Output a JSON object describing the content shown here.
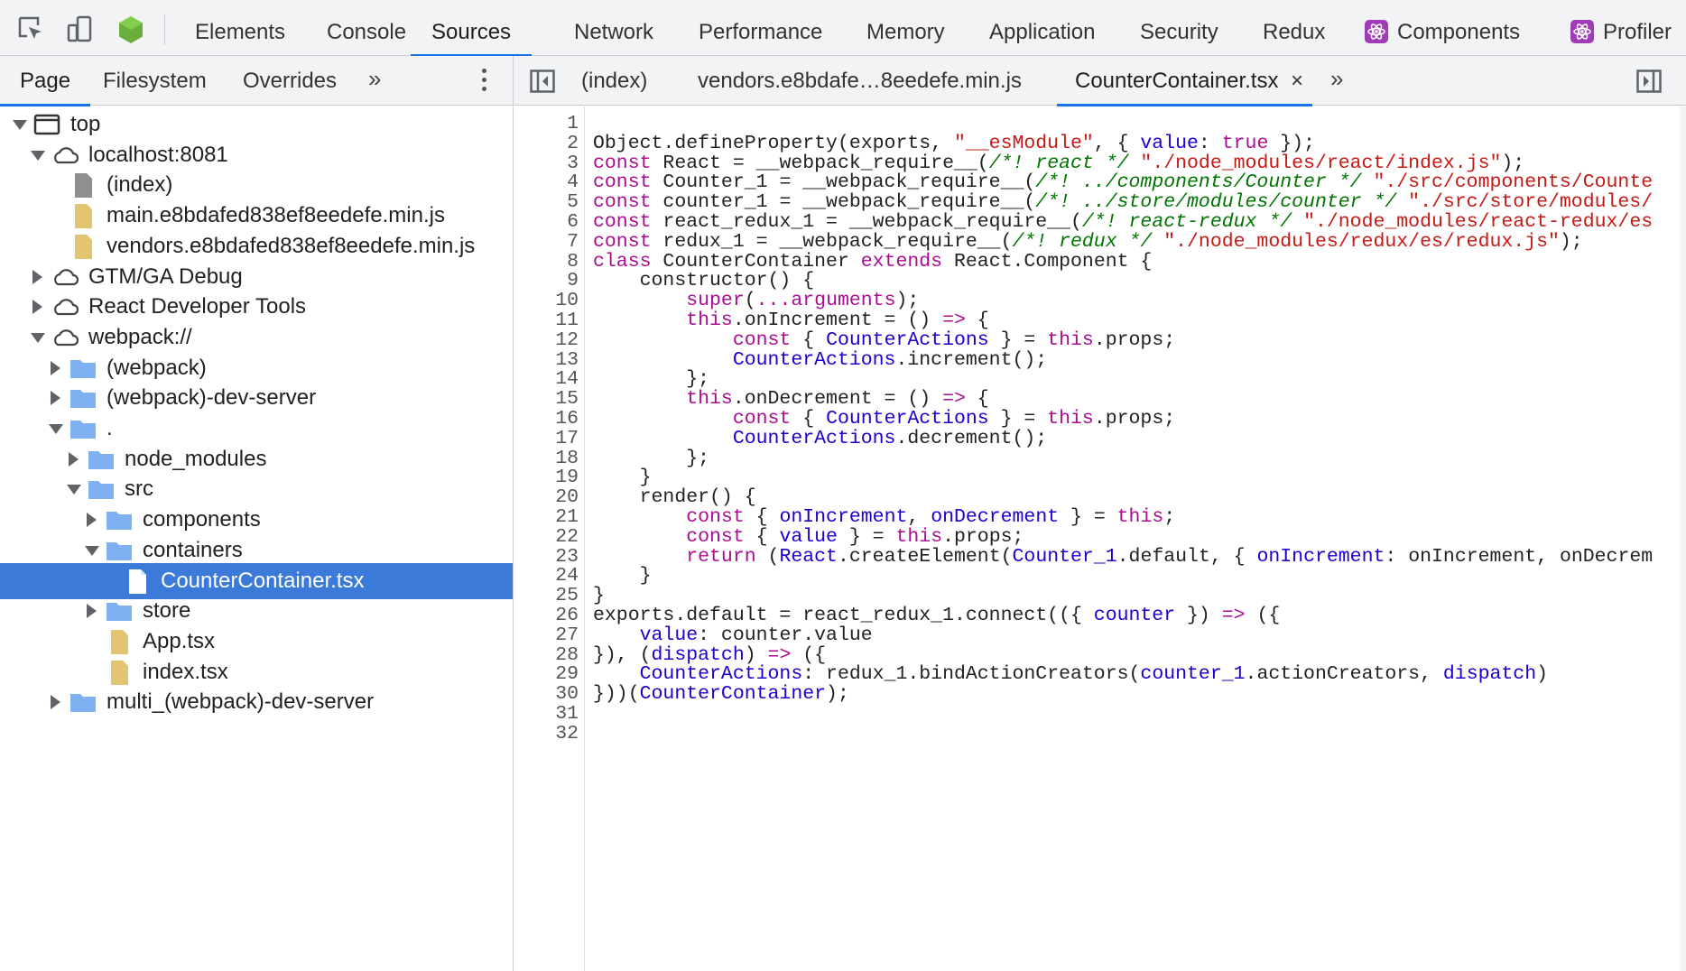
{
  "toolbar": {
    "tabs": [
      "Elements",
      "Console",
      "Sources",
      "Network",
      "Performance",
      "Memory",
      "Application",
      "Security",
      "Redux",
      "Components",
      "Profiler"
    ],
    "active_tab": "Sources",
    "accent_color": "#1a73e8"
  },
  "navigator": {
    "tabs": [
      "Page",
      "Filesystem",
      "Overrides"
    ],
    "more": "»",
    "tree": [
      {
        "label": "top",
        "icon": "frame-icon",
        "state": "open"
      },
      {
        "label": "localhost:8081",
        "icon": "cloud-icon",
        "state": "open"
      },
      {
        "label": "(index)",
        "icon": "file-gray-icon",
        "state": "leaf"
      },
      {
        "label": "main.e8bdafed838ef8eedefe.min.js",
        "icon": "file-js-icon",
        "state": "leaf"
      },
      {
        "label": "vendors.e8bdafed838ef8eedefe.min.js",
        "icon": "file-js-icon",
        "state": "leaf"
      },
      {
        "label": "GTM/GA Debug",
        "icon": "cloud-icon",
        "state": "closed"
      },
      {
        "label": "React Developer Tools",
        "icon": "cloud-icon",
        "state": "closed"
      },
      {
        "label": "webpack://",
        "icon": "cloud-icon",
        "state": "open"
      },
      {
        "label": "(webpack)",
        "icon": "folder-icon",
        "state": "closed"
      },
      {
        "label": "(webpack)-dev-server",
        "icon": "folder-icon",
        "state": "closed"
      },
      {
        "label": ".",
        "icon": "folder-icon",
        "state": "open"
      },
      {
        "label": "node_modules",
        "icon": "folder-icon",
        "state": "closed"
      },
      {
        "label": "src",
        "icon": "folder-icon",
        "state": "open"
      },
      {
        "label": "components",
        "icon": "folder-icon",
        "state": "closed"
      },
      {
        "label": "containers",
        "icon": "folder-icon",
        "state": "open"
      },
      {
        "label": "CounterContainer.tsx",
        "icon": "file-white-icon",
        "state": "leaf",
        "selected": true
      },
      {
        "label": "store",
        "icon": "folder-icon",
        "state": "closed"
      },
      {
        "label": "App.tsx",
        "icon": "file-js-icon",
        "state": "leaf"
      },
      {
        "label": "index.tsx",
        "icon": "file-js-icon",
        "state": "leaf"
      },
      {
        "label": "multi_(webpack)-dev-server",
        "icon": "folder-icon",
        "state": "closed"
      }
    ]
  },
  "editor": {
    "tabs": [
      "(index)",
      "vendors.e8bdafe…8eedefe.min.js",
      "CounterContainer.tsx"
    ],
    "active_tab": "CounterContainer.tsx",
    "close_glyph": "×",
    "more": "»",
    "lines": [
      "",
      "Object.defineProperty(exports, \"__esModule\", { value: true });",
      "const React = __webpack_require__(/*! react */ \"./node_modules/react/index.js\");",
      "const Counter_1 = __webpack_require__(/*! ../components/Counter */ \"./src/components/Counte",
      "const counter_1 = __webpack_require__(/*! ../store/modules/counter */ \"./src/store/modules/",
      "const react_redux_1 = __webpack_require__(/*! react-redux */ \"./node_modules/react-redux/es",
      "const redux_1 = __webpack_require__(/*! redux */ \"./node_modules/redux/es/redux.js\");",
      "class CounterContainer extends React.Component {",
      "    constructor() {",
      "        super(...arguments);",
      "        this.onIncrement = () => {",
      "            const { CounterActions } = this.props;",
      "            CounterActions.increment();",
      "        };",
      "        this.onDecrement = () => {",
      "            const { CounterActions } = this.props;",
      "            CounterActions.decrement();",
      "        };",
      "    }",
      "    render() {",
      "        const { onIncrement, onDecrement } = this;",
      "        const { value } = this.props;",
      "        return (React.createElement(Counter_1.default, { onIncrement: onIncrement, onDecrem",
      "    }",
      "}",
      "exports.default = react_redux_1.connect(({ counter }) => ({",
      "    value: counter.value",
      "}), (dispatch) => ({",
      "    CounterActions: redux_1.bindActionCreators(counter_1.actionCreators, dispatch)",
      "}))(CounterContainer);",
      "",
      ""
    ]
  }
}
